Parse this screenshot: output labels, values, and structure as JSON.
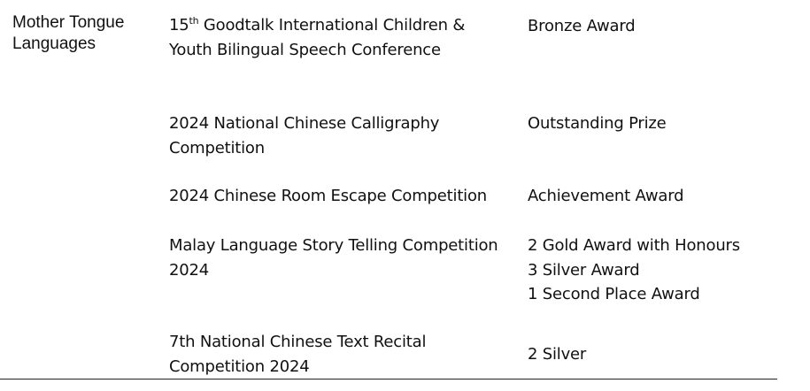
{
  "category": {
    "line1": "Mother Tongue",
    "line2": "Languages"
  },
  "rows": [
    {
      "event": {
        "line1_num": "15",
        "line1_sup": "th",
        "line1_rest": " Goodtalk International Children &",
        "line2": "Youth Bilingual Speech Conference"
      },
      "award": {
        "line1": "Bronze Award"
      }
    },
    {
      "event": {
        "line1": "2024 National Chinese Calligraphy",
        "line2": "Competition"
      },
      "award": {
        "line1": "Outstanding Prize"
      }
    },
    {
      "event": {
        "line1": "2024 Chinese Room Escape Competition"
      },
      "award": {
        "line1": "Achievement Award"
      }
    },
    {
      "event": {
        "line1": "Malay Language Story Telling Competition",
        "line2": "2024"
      },
      "award": {
        "line1": "2 Gold Award with Honours",
        "line2": "3 Silver Award",
        "line3": "1 Second Place Award"
      }
    },
    {
      "event": {
        "line1": "7th National Chinese Text Recital",
        "line2": "Competition 2024"
      },
      "award": {
        "line1": "2 Silver"
      }
    }
  ]
}
